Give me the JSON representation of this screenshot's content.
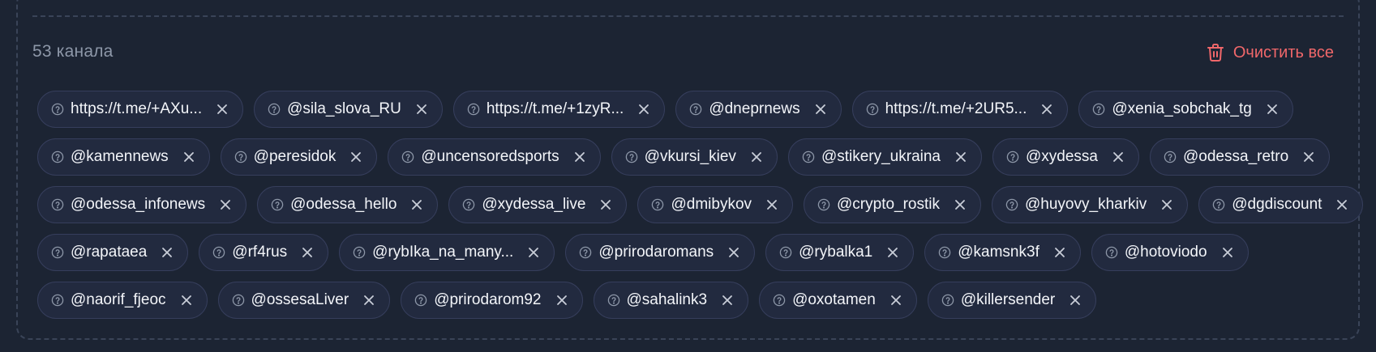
{
  "header": {
    "count_label": "53 канала",
    "clear_label": "Очистить все"
  },
  "icons": {
    "chip_status": "question-circle-icon",
    "chip_remove": "close-icon",
    "clear": "trash-icon"
  },
  "colors": {
    "background": "#1c2433",
    "chip_background": "#222a3f",
    "chip_border": "#363e5c",
    "danger": "#f0676a",
    "muted_text": "#8d97a8"
  },
  "channels": [
    [
      "https://t.me/+AXu...",
      "@sila_slova_RU",
      "https://t.me/+1zyR...",
      "@dneprnews",
      "https://t.me/+2UR5...",
      "@xenia_sobchak_tg"
    ],
    [
      "@kamennews",
      "@peresidok",
      "@uncensoredsports",
      "@vkursi_kiev",
      "@stikery_ukraina",
      "@xydessa",
      "@odessa_retro"
    ],
    [
      "@odessa_infonews",
      "@odessa_hello",
      "@xydessa_live",
      "@dmibykov",
      "@crypto_rostik",
      "@huyovy_kharkiv",
      "@dgdiscount"
    ],
    [
      "@rapataea",
      "@rf4rus",
      "@rybIka_na_many...",
      "@prirodaromans",
      "@rybalka1",
      "@kamsnk3f",
      "@hotoviodo"
    ],
    [
      "@naorif_fjeoc",
      "@ossesaLiver",
      "@prirodarom92",
      "@sahalink3",
      "@oxotamen",
      "@killersender"
    ]
  ]
}
